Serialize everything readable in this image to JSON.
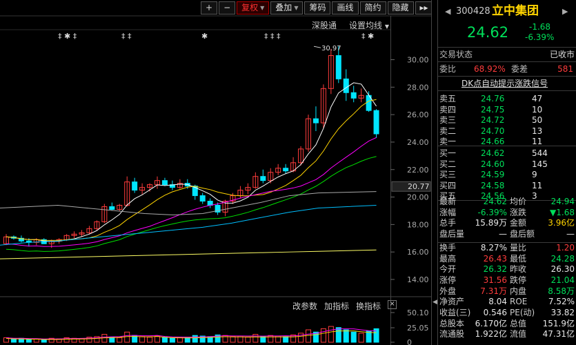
{
  "toolbar": {
    "plus": "+",
    "minus": "−",
    "buttons": [
      "复权",
      "叠加",
      "筹码",
      "画线",
      "简约",
      "隐藏"
    ],
    "more": "▸▸"
  },
  "subbar": {
    "link1": "深股通",
    "link2": "设置均线"
  },
  "volbar": {
    "b1": "改参数",
    "b2": "加指标",
    "b3": "换指标",
    "close": "×"
  },
  "colors": {
    "up": "#ff3c3c",
    "down": "#00e5ff",
    "ma5": "#ffffff",
    "ma10": "#ffd400",
    "ma20": "#ff00ff",
    "ma30": "#00e000",
    "ma60": "#aaaaaa",
    "ma120": "#00bfff",
    "ma250": "#ffff66"
  },
  "markers": {
    "list": [
      "‡ ✱ ‡",
      "‡ ‡",
      "✱",
      "‡ ‡ ‡",
      "‡ ✱"
    ]
  },
  "chart_data": {
    "type": "candlestick",
    "y_ticks": [
      "30.00",
      "28.00",
      "26.00",
      "24.00",
      "22.00",
      "20.00",
      "18.00",
      "16.00",
      "14.00"
    ],
    "ylim": [
      13.2,
      31.2
    ],
    "current_price_label": "20.77",
    "high_annotation": "30.97",
    "vol_ticks": [
      "50.10",
      "25.05",
      "0"
    ],
    "candles": [
      [
        16.6,
        17.3,
        16.5,
        17.1
      ],
      [
        17.1,
        17.2,
        16.9,
        17.0
      ],
      [
        17.0,
        17.2,
        16.7,
        16.8
      ],
      [
        16.8,
        17.0,
        16.4,
        16.7
      ],
      [
        16.7,
        17.0,
        16.5,
        16.9
      ],
      [
        16.9,
        17.0,
        16.6,
        16.6
      ],
      [
        16.6,
        16.9,
        16.3,
        16.8
      ],
      [
        16.8,
        17.0,
        16.6,
        16.9
      ],
      [
        16.9,
        17.3,
        16.8,
        17.2
      ],
      [
        17.2,
        17.5,
        17.0,
        17.3
      ],
      [
        17.3,
        17.6,
        17.1,
        17.4
      ],
      [
        17.4,
        17.9,
        17.3,
        17.7
      ],
      [
        17.7,
        18.3,
        17.6,
        18.2
      ],
      [
        18.2,
        19.5,
        18.1,
        19.3
      ],
      [
        19.3,
        19.6,
        19.0,
        19.1
      ],
      [
        19.1,
        19.5,
        19.0,
        19.4
      ],
      [
        19.4,
        21.5,
        19.3,
        21.1
      ],
      [
        21.1,
        21.4,
        20.3,
        20.5
      ],
      [
        20.5,
        21.0,
        20.2,
        20.7
      ],
      [
        20.7,
        21.0,
        20.4,
        20.9
      ],
      [
        20.9,
        21.5,
        20.6,
        21.2
      ],
      [
        21.2,
        21.4,
        20.8,
        20.9
      ],
      [
        20.9,
        21.2,
        20.5,
        20.7
      ],
      [
        20.7,
        21.3,
        20.6,
        21.0
      ],
      [
        21.0,
        21.3,
        20.6,
        20.8
      ],
      [
        20.8,
        20.9,
        19.8,
        20.1
      ],
      [
        20.1,
        20.3,
        19.5,
        19.7
      ],
      [
        19.7,
        19.9,
        19.2,
        19.4
      ],
      [
        19.4,
        19.6,
        18.7,
        18.9
      ],
      [
        18.9,
        19.8,
        18.6,
        19.7
      ],
      [
        19.7,
        20.3,
        19.5,
        20.1
      ],
      [
        20.1,
        20.8,
        19.9,
        20.5
      ],
      [
        20.5,
        21.0,
        20.2,
        20.7
      ],
      [
        20.7,
        21.8,
        20.6,
        21.5
      ],
      [
        21.5,
        22.0,
        21.0,
        21.2
      ],
      [
        21.2,
        22.1,
        21.0,
        21.8
      ],
      [
        21.8,
        22.4,
        21.6,
        22.1
      ],
      [
        22.1,
        22.4,
        21.7,
        21.9
      ],
      [
        21.9,
        22.9,
        21.8,
        22.5
      ],
      [
        22.5,
        23.7,
        22.3,
        23.5
      ],
      [
        23.5,
        26.0,
        23.3,
        25.7
      ],
      [
        25.7,
        26.6,
        24.8,
        25.4
      ],
      [
        25.4,
        28.2,
        25.0,
        27.9
      ],
      [
        27.9,
        30.8,
        27.5,
        30.3
      ],
      [
        30.3,
        30.97,
        28.3,
        28.6
      ],
      [
        28.6,
        29.3,
        27.0,
        27.6
      ],
      [
        27.6,
        28.1,
        26.9,
        27.2
      ],
      [
        27.2,
        27.9,
        26.9,
        27.4
      ],
      [
        27.4,
        27.7,
        26.2,
        26.3
      ],
      [
        26.3,
        26.4,
        24.3,
        24.6
      ]
    ],
    "volumes": [
      8,
      6,
      7,
      5,
      6,
      5,
      7,
      6,
      8,
      7,
      6,
      9,
      10,
      14,
      9,
      8,
      18,
      12,
      10,
      9,
      11,
      9,
      8,
      9,
      8,
      12,
      11,
      10,
      13,
      12,
      10,
      11,
      9,
      14,
      10,
      12,
      11,
      10,
      13,
      16,
      22,
      18,
      24,
      28,
      26,
      22,
      18,
      16,
      20,
      24
    ],
    "ma_lines": [
      {
        "color": "#aaaaaa",
        "values": [
          19.2,
          19.3,
          19.4,
          19.2,
          19.0,
          18.8,
          18.7,
          18.8,
          19.2,
          19.6,
          20.1,
          20.3,
          20.35,
          20.4
        ]
      },
      {
        "color": "#00bfff",
        "values": [
          16.5,
          16.7,
          16.8,
          17.0,
          17.2,
          17.4,
          17.6,
          17.8,
          18.1,
          18.5,
          18.9,
          19.2,
          19.3,
          19.4
        ]
      },
      {
        "color": "#ffff66",
        "values": [
          15.5,
          15.55,
          15.6,
          15.65,
          15.7,
          15.75,
          15.8,
          15.85,
          15.9,
          15.95,
          16.0,
          16.05,
          16.1,
          16.15
        ]
      }
    ]
  },
  "side": {
    "code": "300428",
    "name": "立中集团",
    "price": "24.62",
    "change": "-1.68",
    "change_pct": "-6.39%",
    "trade_status_label": "交易状态",
    "trade_status": "已收市",
    "weibi_label": "委比",
    "weibi": "68.92%",
    "weicha_label": "委差",
    "weicha": "581",
    "signal_link": "DK点自动提示涨跌信号",
    "asks": [
      {
        "label": "卖五",
        "price": "24.76",
        "vol": "47"
      },
      {
        "label": "卖四",
        "price": "24.75",
        "vol": "10"
      },
      {
        "label": "卖三",
        "price": "24.72",
        "vol": "50"
      },
      {
        "label": "卖二",
        "price": "24.70",
        "vol": "13"
      },
      {
        "label": "卖一",
        "price": "24.66",
        "vol": "11"
      }
    ],
    "bids": [
      {
        "label": "买一",
        "price": "24.62",
        "vol": "544"
      },
      {
        "label": "买二",
        "price": "24.60",
        "vol": "145"
      },
      {
        "label": "买三",
        "price": "24.59",
        "vol": "9"
      },
      {
        "label": "买四",
        "price": "24.58",
        "vol": "11"
      },
      {
        "label": "买五",
        "price": "24.56",
        "vol": "3"
      }
    ],
    "stats": [
      {
        "l1": "最新",
        "v1": "24.62",
        "c1": "green",
        "l2": "均价",
        "v2": "24.94",
        "c2": "green"
      },
      {
        "l1": "涨幅",
        "v1": "-6.39%",
        "c1": "green",
        "l2": "涨跌",
        "v2": "▼1.68",
        "c2": "green"
      },
      {
        "l1": "总手",
        "v1": "15.89万",
        "c1": "white",
        "l2": "金额",
        "v2": "3.96亿",
        "c2": "yellow"
      },
      {
        "l1": "盘后量",
        "v1": "—",
        "c1": "white",
        "l2": "盘后额",
        "v2": "—",
        "c2": "white"
      },
      {
        "l1": "换手",
        "v1": "8.27%",
        "c1": "white",
        "l2": "量比",
        "v2": "1.20",
        "c2": "red"
      },
      {
        "l1": "最高",
        "v1": "26.43",
        "c1": "red",
        "l2": "最低",
        "v2": "24.28",
        "c2": "green"
      },
      {
        "l1": "今开",
        "v1": "26.32",
        "c1": "green",
        "l2": "昨收",
        "v2": "26.30",
        "c2": "white"
      },
      {
        "l1": "涨停",
        "v1": "31.56",
        "c1": "red",
        "l2": "跌停",
        "v2": "21.04",
        "c2": "green"
      },
      {
        "l1": "外盘",
        "v1": "7.31万",
        "c1": "red",
        "l2": "内盘",
        "v2": "8.58万",
        "c2": "green"
      },
      {
        "l1": "净资产",
        "v1": "8.04",
        "c1": "white",
        "l2": "ROE",
        "v2": "7.52%",
        "c2": "white"
      },
      {
        "l1": "收益(三)",
        "v1": "0.546",
        "c1": "white",
        "l2": "PE(动)",
        "v2": "33.82",
        "c2": "white"
      },
      {
        "l1": "总股本",
        "v1": "6.170亿",
        "c1": "white",
        "l2": "总值",
        "v2": "151.9亿",
        "c2": "white"
      },
      {
        "l1": "流通股",
        "v1": "1.922亿",
        "c1": "white",
        "l2": "流值",
        "v2": "47.31亿",
        "c2": "white"
      }
    ]
  }
}
